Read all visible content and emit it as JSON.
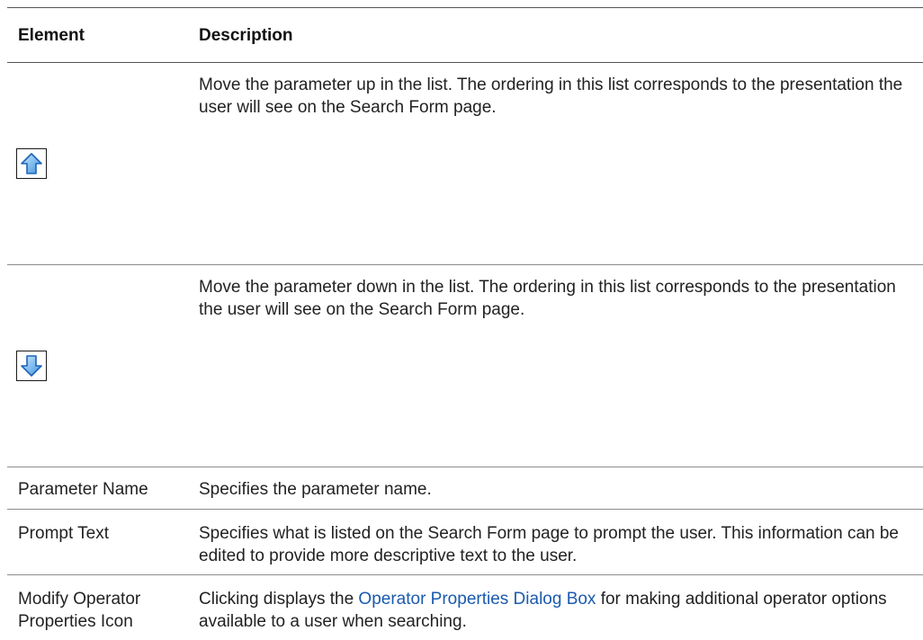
{
  "table": {
    "headers": {
      "element": "Element",
      "description": "Description"
    },
    "rows": [
      {
        "element_icon": "arrow-up-icon",
        "description": "Move the parameter up in the list. The ordering in this list corresponds to the presentation the user will see on the Search Form page."
      },
      {
        "element_icon": "arrow-down-icon",
        "description": "Move the parameter down in the list. The ordering in this list corresponds to the presentation the user will see on the Search Form page."
      },
      {
        "element": "Parameter Name",
        "description": "Specifies the parameter name."
      },
      {
        "element": "Prompt Text",
        "description": "Specifies what is listed on the Search Form page to prompt the user. This information can be edited to provide more descriptive text to the user."
      },
      {
        "element": "Modify Operator Properties Icon",
        "description_prefix": "Clicking displays the ",
        "description_link": "Operator Properties Dialog Box",
        "description_suffix": " for making additional operator options available to a user when searching."
      }
    ]
  },
  "colors": {
    "link": "#1a5aad",
    "icon_fill": "#5aaef0",
    "icon_stroke": "#1f63b8"
  }
}
